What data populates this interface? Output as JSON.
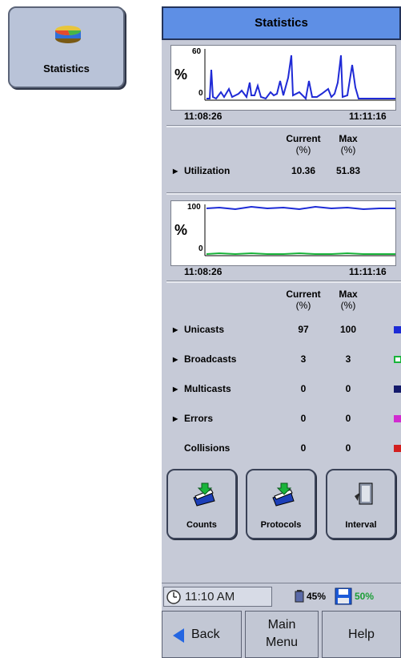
{
  "launcher": {
    "label": "Statistics",
    "icon": "pie-chart-icon"
  },
  "title": "Statistics",
  "utilization_chart": {
    "y_max_label": "60",
    "y_min_label": "0",
    "unit_label": "%",
    "start_time": "11:08:26",
    "end_time": "11:11:16",
    "series_color": "#1f2ad6"
  },
  "utilization_table": {
    "col_current": "Current",
    "col_current_unit": "(%)",
    "col_max": "Max",
    "col_max_unit": "(%)",
    "rows": [
      {
        "name": "Utilization",
        "current": "10.36",
        "max": "51.83"
      }
    ]
  },
  "traffic_chart": {
    "y_max_label": "100",
    "y_min_label": "0",
    "unit_label": "%",
    "start_time": "11:08:26",
    "end_time": "11:11:16"
  },
  "traffic_table": {
    "col_current": "Current",
    "col_current_unit": "(%)",
    "col_max": "Max",
    "col_max_unit": "(%)",
    "rows": [
      {
        "name": "Unicasts",
        "current": "97",
        "max": "100",
        "color": "#1c2bd6",
        "expandable": true
      },
      {
        "name": "Broadcasts",
        "current": "3",
        "max": "3",
        "color": "#19b43a",
        "expandable": true
      },
      {
        "name": "Multicasts",
        "current": "0",
        "max": "0",
        "color": "#141a6b",
        "expandable": true
      },
      {
        "name": "Errors",
        "current": "0",
        "max": "0",
        "color": "#d12ad0",
        "expandable": true
      },
      {
        "name": "Collisions",
        "current": "0",
        "max": "0",
        "color": "#d31f1f",
        "expandable": false
      }
    ]
  },
  "toolbar": {
    "counts_label": "Counts",
    "protocols_label": "Protocols",
    "interval_label": "Interval"
  },
  "status": {
    "time": "11:10 AM",
    "battery": "45%",
    "storage": "50%"
  },
  "nav": {
    "back": "Back",
    "main_menu_line1": "Main",
    "main_menu_line2": "Menu",
    "help": "Help"
  }
}
